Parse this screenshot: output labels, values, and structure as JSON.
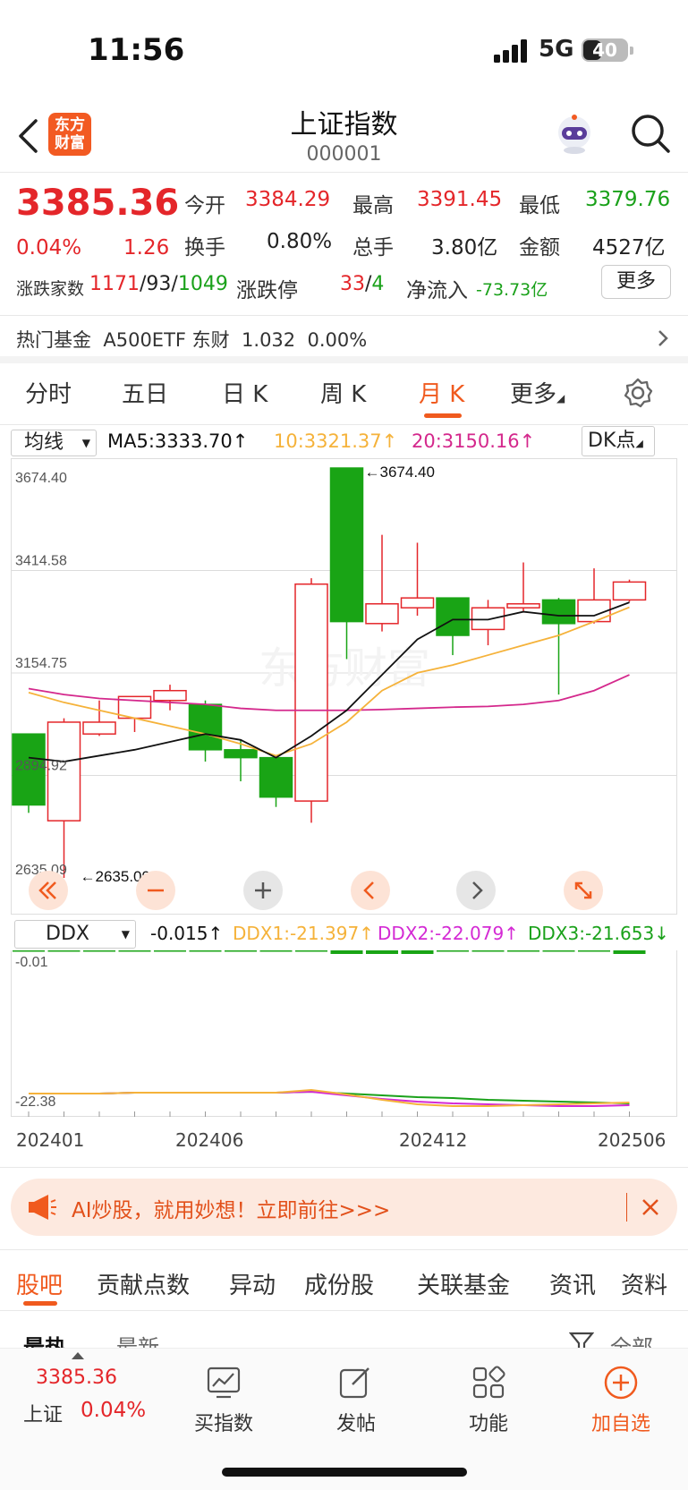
{
  "status": {
    "time": "11:56",
    "network": "5G",
    "battery": "40"
  },
  "header": {
    "brand_line1": "东方",
    "brand_line2": "财富",
    "title": "上证指数",
    "code": "000001"
  },
  "quote": {
    "price": "3385.36",
    "change_pct": "0.04%",
    "change": "1.26",
    "open_label": "今开",
    "open": "3384.29",
    "high_label": "最高",
    "high": "3391.45",
    "low_label": "最低",
    "low": "3379.76",
    "turnover_label": "换手",
    "turnover": "0.80%",
    "volume_label": "总手",
    "volume": "3.80亿",
    "amount_label": "金额",
    "amount": "4527亿",
    "breadth_label": "涨跌家数",
    "breadth_up": "1171",
    "breadth_flat": "93",
    "breadth_down": "1049",
    "limit_label": "涨跌停",
    "limit_up": "33",
    "limit_down": "4",
    "inflow_label": "净流入",
    "inflow": "-73.73亿",
    "more_label": "更多"
  },
  "fund": {
    "label": "热门基金",
    "name": "A500ETF 东财",
    "price": "1.032",
    "pct": "0.00%"
  },
  "tabs": [
    {
      "label": "分时"
    },
    {
      "label": "五日"
    },
    {
      "label": "日 K"
    },
    {
      "label": "周 K"
    },
    {
      "label": "月 K"
    },
    {
      "label": "更多"
    }
  ],
  "active_tab": "月 K",
  "ma": {
    "select": "均线",
    "ma5": "MA5:3333.70↑",
    "ma10": "10:3321.37↑",
    "ma20": "20:3150.16↑",
    "dk": "DK点"
  },
  "chart_data": {
    "type": "candlestick",
    "y_ticks": [
      "3674.40",
      "3414.58",
      "3154.75",
      "2894.92",
      "2635.09"
    ],
    "ylim": [
      2635.09,
      3674.4
    ],
    "max_marker": "3674.40",
    "min_marker": "2635.09",
    "x_labels": [
      "202401",
      "202406",
      "202412",
      "202506"
    ],
    "candles": [
      {
        "o": 3000,
        "c": 2820,
        "h": 3000,
        "l": 2800
      },
      {
        "o": 2780,
        "c": 3030,
        "h": 3040,
        "l": 2635.09
      },
      {
        "o": 3000,
        "c": 3030,
        "h": 3085,
        "l": 2995
      },
      {
        "o": 3040,
        "c": 3095,
        "h": 3095,
        "l": 3005
      },
      {
        "o": 3085,
        "c": 3110,
        "h": 3125,
        "l": 3060
      },
      {
        "o": 3075,
        "c": 2960,
        "h": 3085,
        "l": 2930
      },
      {
        "o": 2960,
        "c": 2940,
        "h": 2985,
        "l": 2880
      },
      {
        "o": 2940,
        "c": 2840,
        "h": 2940,
        "l": 2815
      },
      {
        "o": 2830,
        "c": 3380,
        "h": 3395,
        "l": 2775
      },
      {
        "o": 3674.4,
        "c": 3285,
        "h": 3674.4,
        "l": 3190
      },
      {
        "o": 3280,
        "c": 3330,
        "h": 3505,
        "l": 3260
      },
      {
        "o": 3320,
        "c": 3345,
        "h": 3485,
        "l": 3300
      },
      {
        "o": 3345,
        "c": 3250,
        "h": 3345,
        "l": 3200
      },
      {
        "o": 3265,
        "c": 3320,
        "h": 3340,
        "l": 3225
      },
      {
        "o": 3320,
        "c": 3330,
        "h": 3435,
        "l": 3310
      },
      {
        "o": 3340,
        "c": 3280,
        "h": 3345,
        "l": 3100
      },
      {
        "o": 3285,
        "c": 3340,
        "h": 3420,
        "l": 3280
      },
      {
        "o": 3340,
        "c": 3385.36,
        "h": 3391.45,
        "l": 3335
      }
    ],
    "ma5": [
      2940,
      2930,
      2945,
      2960,
      2980,
      3000,
      2985,
      2940,
      2995,
      3060,
      3150,
      3240,
      3290,
      3290,
      3310,
      3300,
      3300,
      3333.7
    ],
    "ma10": [
      3105,
      3080,
      3060,
      3040,
      3020,
      3000,
      2975,
      2945,
      2975,
      3030,
      3110,
      3155,
      3175,
      3200,
      3225,
      3250,
      3285,
      3321.37
    ],
    "ma20": [
      3115,
      3100,
      3090,
      3085,
      3080,
      3075,
      3065,
      3060,
      3060,
      3060,
      3062,
      3065,
      3068,
      3070,
      3075,
      3085,
      3110,
      3150.16
    ],
    "colors": {
      "up": "#e4262a",
      "down": "#19a415",
      "ma5": "#111111",
      "ma10": "#f5b23a",
      "ma20": "#d4288c"
    }
  },
  "ddx": {
    "select": "DDX",
    "value": "-0.015↑",
    "ddx1": "DDX1:-21.397↑",
    "ddx2": "DDX2:-22.079↑",
    "ddx3": "DDX3:-21.653↓",
    "top_label": "-0.01",
    "bottom_label": "-22.38"
  },
  "banner": {
    "text": "AI炒股，就用妙想！立即前往>>>"
  },
  "bottom_tabs": [
    "股吧",
    "贡献点数",
    "异动",
    "成份股",
    "关联基金",
    "资讯",
    "资料"
  ],
  "peek": {
    "left1": "最热",
    "left2": "最新",
    "right": "全部"
  },
  "bottom_nav": {
    "price": "3385.36",
    "name": "上证",
    "pct": "0.04%",
    "buy": "买指数",
    "post": "发帖",
    "func": "功能",
    "add": "加自选"
  }
}
